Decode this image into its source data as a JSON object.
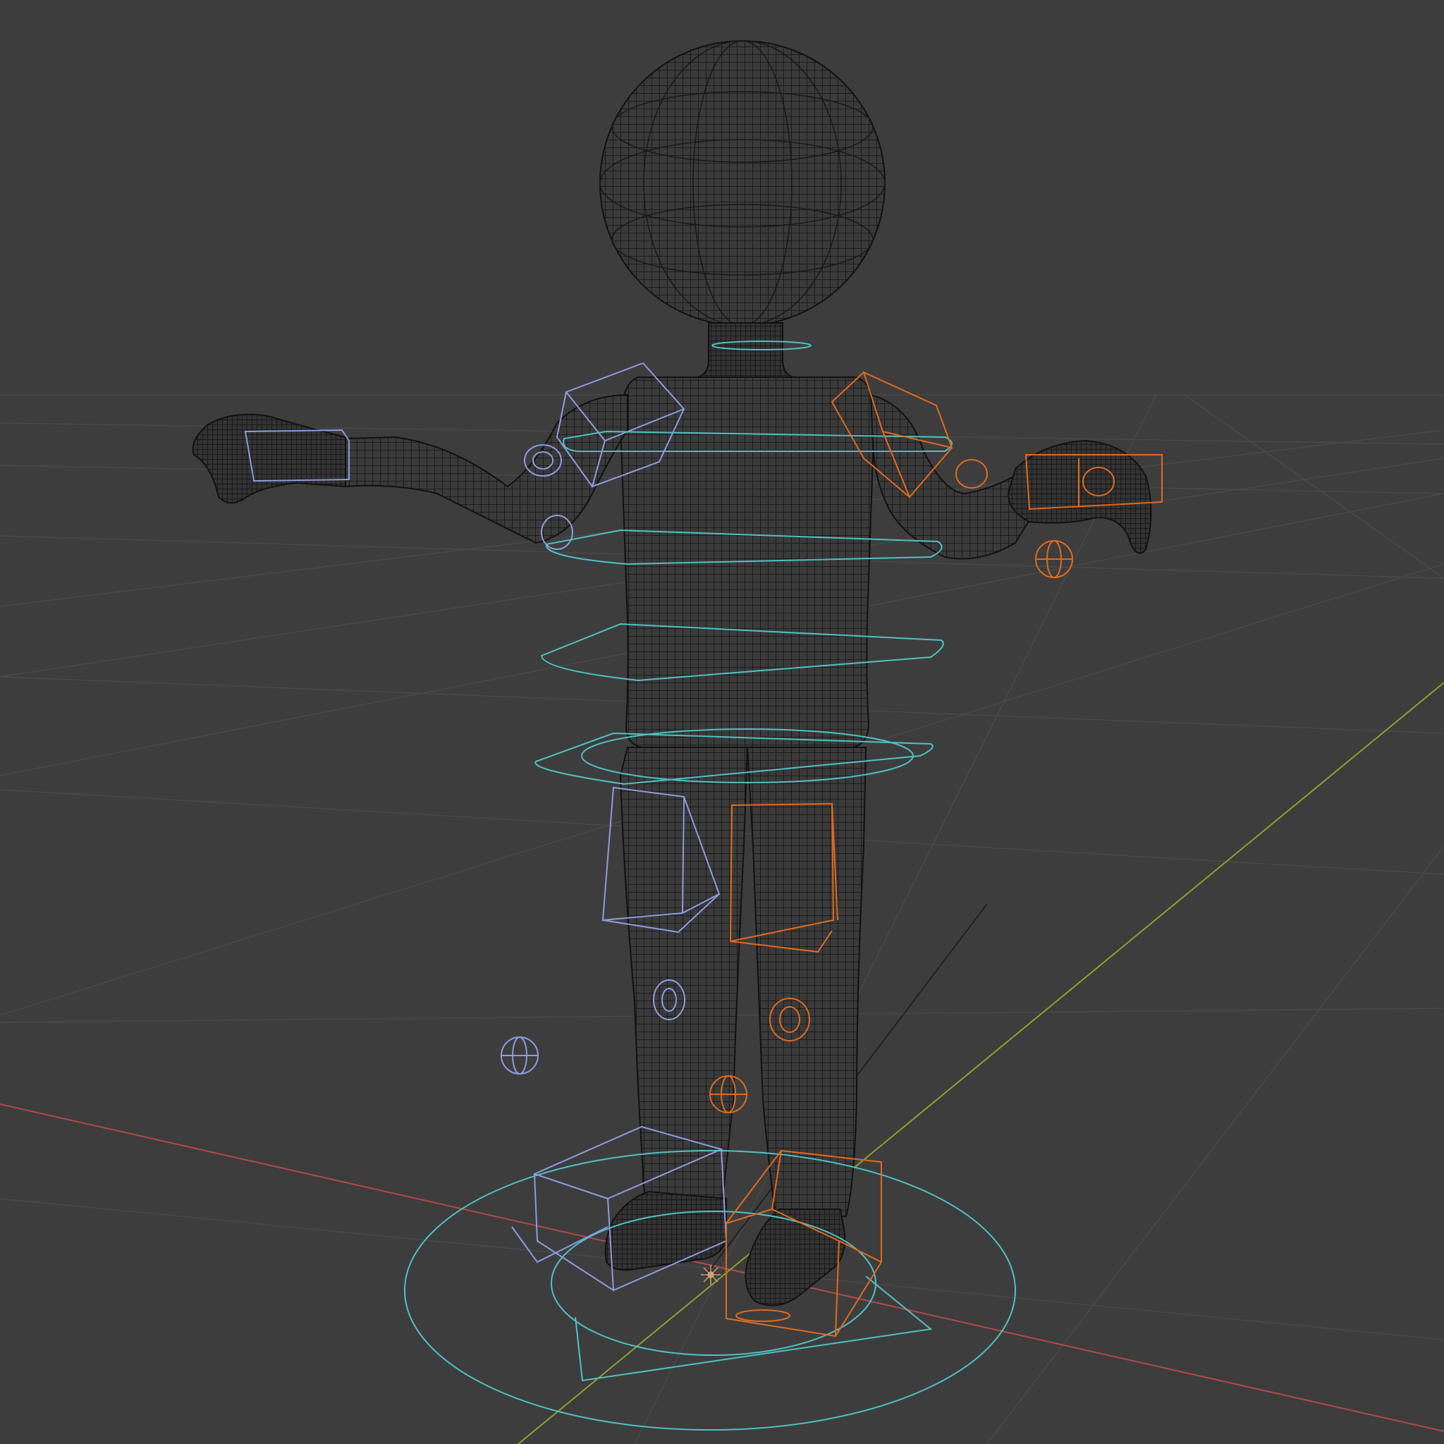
{
  "viewport": {
    "background": "#3d3d3d",
    "grid_color": "#4a4a4a",
    "axis_x_color": "#b34a4a",
    "axis_y_color": "#8fa02a"
  },
  "mesh": {
    "wire_color": "#111111",
    "object": "wireframe-character"
  },
  "rig": {
    "center_controls_color": "#4ec2c6",
    "left_side_controls_color": "#8e9ce0",
    "right_side_controls_color": "#e06a1e"
  },
  "icons": [
    "origin-pivot-icon"
  ]
}
